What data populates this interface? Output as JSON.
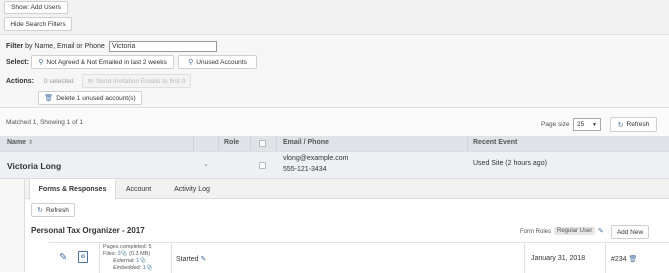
{
  "top": {
    "show_add_users": "Show: Add Users",
    "hide_search_filters": "Hide Search Filters"
  },
  "filter": {
    "label_bold": "Filter",
    "label_rest": " by Name, Email or Phone",
    "value": "Victoria",
    "select_label": "Select:",
    "not_agreed_button": "Not Agreed & Not Emailed in last 2 weeks",
    "unused_accounts_button": "Unused Accounts",
    "actions_label": "Actions:",
    "selected_count": "0 selected",
    "send_invitation_button": "Send Invitation Emails to first 0",
    "delete_unused_button": "Delete 1 unused account(s)"
  },
  "results": {
    "matched_text": "Matched 1, Showing 1 of 1",
    "page_size_label": "Page size",
    "page_size_value": "25",
    "refresh_label": "Refresh"
  },
  "table": {
    "headers": {
      "name": "Name",
      "role": "Role",
      "email_phone": "Email / Phone",
      "recent_event": "Recent Event"
    },
    "rows": [
      {
        "name": "Victoria Long",
        "role": "",
        "email": "vlong@example.com",
        "phone": "555-121-3434",
        "recent_event": "Used Site (2 hours ago)"
      }
    ]
  },
  "detail": {
    "tabs": [
      "Forms & Responses",
      "Account",
      "Activity Log"
    ],
    "active_tab": "Forms & Responses",
    "refresh_label": "Refresh",
    "form": {
      "title": "Personal Tax Organizer - 2017",
      "roles_label": "Form Roles",
      "role_badge": "Regular User",
      "add_new_label": "Add New",
      "entry": {
        "pages_completed": "Pages completed: 5",
        "files_prefix": "Files: ",
        "files_count": "3",
        "files_size": " (0.3 MB)",
        "external_label": "External:",
        "external_count": "1",
        "embedded_label": "Embedded:",
        "embedded_count": "1",
        "status": "Started",
        "date": "January 31, 2018",
        "number": "#234"
      }
    }
  },
  "colors": {
    "accent": "#4a6fa5",
    "header_bg": "#dfe3e7",
    "row_bg": "#eef1f4"
  }
}
